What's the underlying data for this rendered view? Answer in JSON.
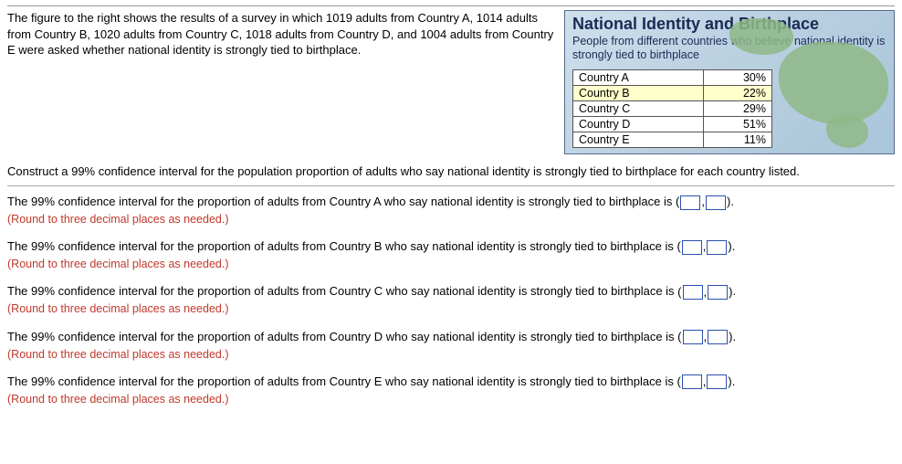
{
  "intro": "The figure to the right shows the results of a survey in which 1019 adults from Country A, 1014 adults from Country B, 1020 adults from Country C, 1018 adults from Country D, and 1004 adults from Country E were asked whether national identity is strongly tied to birthplace.",
  "figure": {
    "title": "National Identity and Birthplace",
    "subtitle": "People from different countries who believe national identity is strongly tied to birthplace"
  },
  "chart_data": {
    "type": "table",
    "rows": [
      {
        "country": "Country A",
        "pct": "30%",
        "hl": false
      },
      {
        "country": "Country B",
        "pct": "22%",
        "hl": true
      },
      {
        "country": "Country C",
        "pct": "29%",
        "hl": false
      },
      {
        "country": "Country D",
        "pct": "51%",
        "hl": false
      },
      {
        "country": "Country E",
        "pct": "11%",
        "hl": false
      }
    ]
  },
  "prompt": "Construct a 99% confidence interval for the population proportion of adults who say national identity is strongly tied to birthplace for each country listed.",
  "hint": "(Round to three decimal places as needed.)",
  "tail": ".",
  "questions": [
    "The 99% confidence interval for the proportion of adults from Country A who say national identity is strongly tied to birthplace is ",
    "The 99% confidence interval for the proportion of adults from Country B who say national identity is strongly tied to birthplace is ",
    "The 99% confidence interval for the proportion of adults from Country C who say national identity is strongly tied to birthplace is ",
    "The 99% confidence interval for the proportion of adults from Country D who say national identity is strongly tied to birthplace is ",
    "The 99% confidence interval for the proportion of adults from Country E who say national identity is strongly tied to birthplace is "
  ]
}
